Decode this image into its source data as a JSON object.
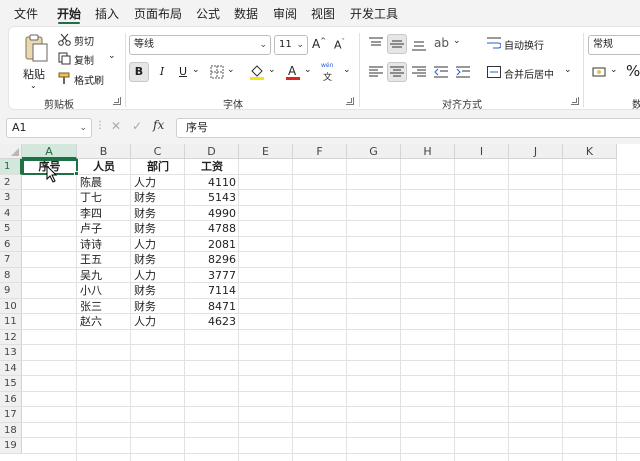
{
  "menu": {
    "tabs": [
      "文件",
      "开始",
      "插入",
      "页面布局",
      "公式",
      "数据",
      "审阅",
      "视图",
      "开发工具"
    ],
    "active": "开始"
  },
  "ribbon": {
    "clipboard": {
      "paste": "粘贴",
      "cut": "剪切",
      "copy": "复制",
      "format_painter": "格式刷",
      "group": "剪贴板"
    },
    "font": {
      "name": "等线",
      "size": "11",
      "bold": "B",
      "italic": "I",
      "underline": "U",
      "phonetic_top": "wén",
      "phonetic_bottom": "文",
      "group": "字体"
    },
    "alignment": {
      "wrap_text": "自动换行",
      "merge_center": "合并后居中",
      "group": "对齐方式"
    },
    "number": {
      "format": "常规",
      "percent": "%",
      "group": "数"
    }
  },
  "formula_bar": {
    "name_box": "A1",
    "fx": "fx",
    "formula": "序号"
  },
  "sheet": {
    "columns": [
      "A",
      "B",
      "C",
      "D",
      "E",
      "F",
      "G",
      "H",
      "I",
      "J",
      "K"
    ],
    "rows": [
      "1",
      "2",
      "3",
      "4",
      "5",
      "6",
      "7",
      "8",
      "9",
      "10",
      "11",
      "12",
      "13",
      "14",
      "15",
      "16",
      "17",
      "18",
      "19"
    ],
    "headers": [
      "序号",
      "人员",
      "部门",
      "工资"
    ],
    "data": [
      {
        "name": "陈晨",
        "dept": "人力",
        "salary": "4110"
      },
      {
        "name": "丁七",
        "dept": "财务",
        "salary": "5143"
      },
      {
        "name": "李四",
        "dept": "财务",
        "salary": "4990"
      },
      {
        "name": "卢子",
        "dept": "财务",
        "salary": "4788"
      },
      {
        "name": "诗诗",
        "dept": "人力",
        "salary": "2081"
      },
      {
        "name": "王五",
        "dept": "财务",
        "salary": "8296"
      },
      {
        "name": "吴九",
        "dept": "人力",
        "salary": "3777"
      },
      {
        "name": "小八",
        "dept": "财务",
        "salary": "7114"
      },
      {
        "name": "张三",
        "dept": "财务",
        "salary": "8471"
      },
      {
        "name": "赵六",
        "dept": "人力",
        "salary": "4623"
      }
    ]
  }
}
